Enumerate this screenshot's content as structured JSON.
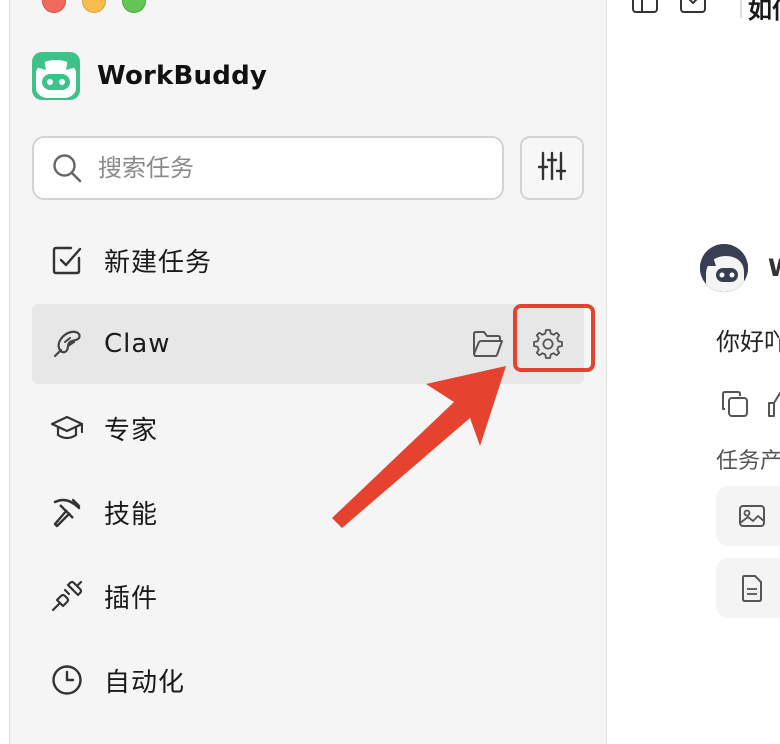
{
  "app": {
    "name": "WorkBuddy"
  },
  "sidebar": {
    "search": {
      "placeholder": "搜索任务"
    },
    "items": [
      {
        "label": "新建任务",
        "icon": "new-task-icon"
      },
      {
        "label": "Claw",
        "icon": "claw-icon",
        "active": true
      },
      {
        "label": "专家",
        "icon": "graduation-cap-icon"
      },
      {
        "label": "技能",
        "icon": "pickaxe-icon"
      },
      {
        "label": "插件",
        "icon": "plug-icon"
      },
      {
        "label": "自动化",
        "icon": "clock-icon"
      }
    ]
  },
  "main": {
    "title_fragment": "如何",
    "sender_fragment": "W",
    "greeting_fragment": "你好吖",
    "output_label_fragment": "任务产"
  },
  "colors": {
    "accent_red": "#e5432f",
    "brand_green": "#3fc18a",
    "sidebar_bg": "#f5f5f5",
    "active_item_bg": "#e7e7e7"
  }
}
